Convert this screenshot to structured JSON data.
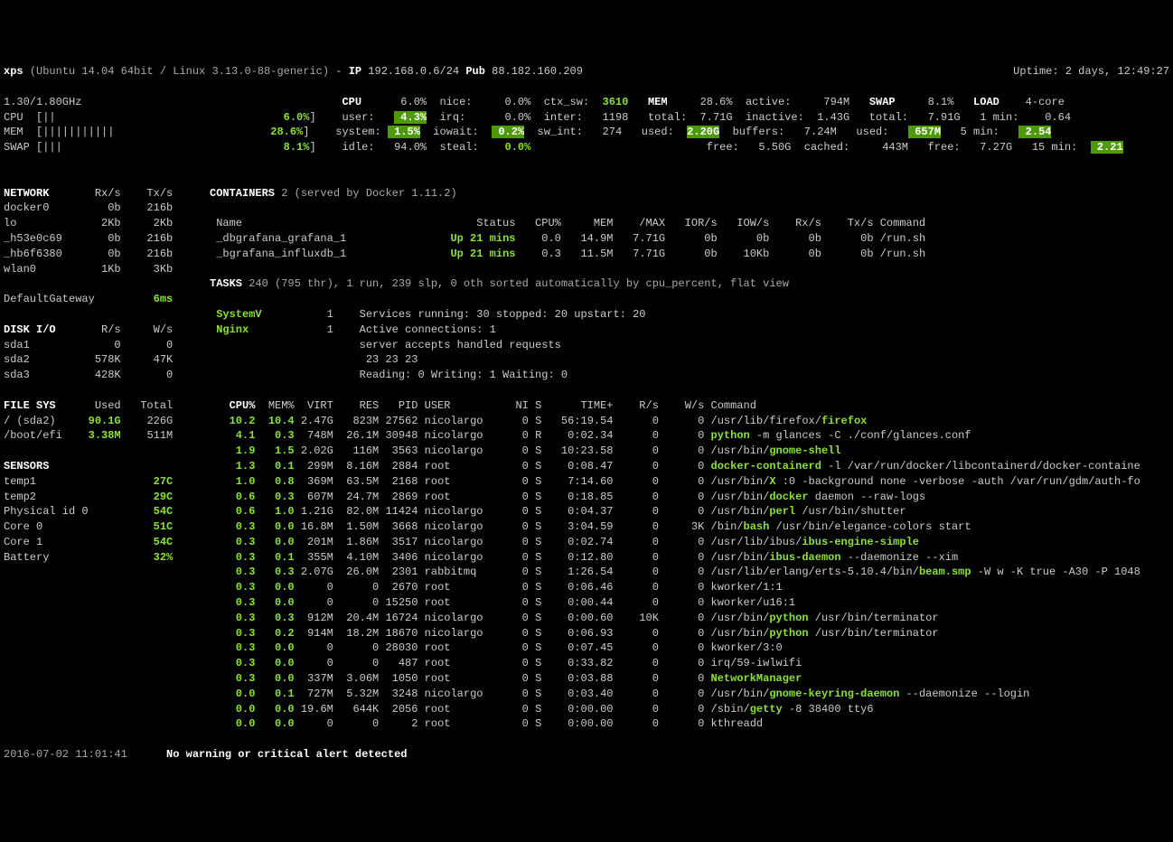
{
  "header": {
    "hostname": "xps",
    "os": "(Ubuntu 14.04 64bit / Linux 3.13.0-88-generic)",
    "ip_label": "IP",
    "ip": "192.168.0.6/24",
    "pub_label": "Pub",
    "pub": "88.182.160.209",
    "uptime": "Uptime: 2 days, 12:49:27"
  },
  "quickbar": {
    "freq": "1.30/1.80GHz",
    "cpu_bar": "CPU  [||",
    "cpu_pct": "6.0%",
    "mem_bar": "MEM  [|||||||||||",
    "mem_pct": "28.6%",
    "swap_bar": "SWAP [|||",
    "swap_pct": "8.1%"
  },
  "cpu": {
    "title": "CPU",
    "total": "6.0%",
    "user": "4.3%",
    "system": "1.5%",
    "idle": "94.0%",
    "nice": "0.0%",
    "irq": "0.0%",
    "iowait": "0.2%",
    "steal": "0.0%",
    "ctx_sw": "3610",
    "inter": "1198",
    "sw_int": "274"
  },
  "mem": {
    "title": "MEM",
    "pct": "28.6%",
    "total": "7.71G",
    "used": "2.20G",
    "free": "5.50G",
    "active": "794M",
    "inactive": "1.43G",
    "buffers": "7.24M",
    "cached": "443M"
  },
  "swap": {
    "title": "SWAP",
    "pct": "8.1%",
    "total": "7.91G",
    "used": "657M",
    "free": "7.27G"
  },
  "load": {
    "title": "LOAD",
    "core": "4-core",
    "min1": "0.64",
    "min5": "2.54",
    "min15": "2.21"
  },
  "network": {
    "title": "NETWORK",
    "cols": [
      "Rx/s",
      "Tx/s"
    ],
    "rows": [
      {
        "name": "docker0",
        "rx": "0b",
        "tx": "216b"
      },
      {
        "name": "lo",
        "rx": "2Kb",
        "tx": "2Kb"
      },
      {
        "name": "_h53e0c69",
        "rx": "0b",
        "tx": "216b"
      },
      {
        "name": "_hb6f6380",
        "rx": "0b",
        "tx": "216b"
      },
      {
        "name": "wlan0",
        "rx": "1Kb",
        "tx": "3Kb"
      }
    ],
    "gateway_label": "DefaultGateway",
    "gateway": "6ms"
  },
  "diskio": {
    "title": "DISK I/O",
    "cols": [
      "R/s",
      "W/s"
    ],
    "rows": [
      {
        "name": "sda1",
        "r": "0",
        "w": "0"
      },
      {
        "name": "sda2",
        "r": "578K",
        "w": "47K"
      },
      {
        "name": "sda3",
        "r": "428K",
        "w": "0"
      }
    ]
  },
  "fs": {
    "title": "FILE SYS",
    "cols": [
      "Used",
      "Total"
    ],
    "rows": [
      {
        "name": "/ (sda2)",
        "used": "90.1G",
        "total": "226G",
        "hl": true
      },
      {
        "name": "/boot/efi",
        "used": "3.38M",
        "total": "511M",
        "hl": true
      }
    ]
  },
  "sensors": {
    "title": "SENSORS",
    "rows": [
      {
        "name": "temp1",
        "val": "27C"
      },
      {
        "name": "temp2",
        "val": "29C"
      },
      {
        "name": "Physical id 0",
        "val": "54C"
      },
      {
        "name": "Core 0",
        "val": "51C"
      },
      {
        "name": "Core 1",
        "val": "54C"
      },
      {
        "name": "Battery",
        "val": "32%"
      }
    ]
  },
  "containers": {
    "title": "CONTAINERS",
    "count": "2",
    "served": "(served by Docker 1.11.2)",
    "header": [
      "Name",
      "Status",
      "CPU%",
      "MEM",
      "/MAX",
      "IOR/s",
      "IOW/s",
      "Rx/s",
      "Tx/s",
      "Command"
    ],
    "rows": [
      {
        "name": "_dbgrafana_grafana_1",
        "status": "Up 21 mins",
        "cpu": "0.0",
        "mem": "14.9M",
        "max": "7.71G",
        "ior": "0b",
        "iow": "0b",
        "rx": "0b",
        "tx": "0b",
        "cmd": "/run.sh"
      },
      {
        "name": "_bgrafana_influxdb_1",
        "status": "Up 21 mins",
        "cpu": "0.3",
        "mem": "11.5M",
        "max": "7.71G",
        "ior": "0b",
        "iow": "10Kb",
        "rx": "0b",
        "tx": "0b",
        "cmd": "/run.sh"
      }
    ]
  },
  "tasks": {
    "line": "TASKS 240 (795 thr), 1 run, 239 slp, 0 oth sorted automatically by cpu_percent, flat view"
  },
  "amp": {
    "systemv": {
      "label": "SystemV",
      "count": "1",
      "text": "Services running: 30 stopped: 20 upstart: 20"
    },
    "nginx": {
      "label": "Nginx",
      "count": "1",
      "lines": [
        "Active connections: 1",
        "server accepts handled requests",
        " 23 23 23",
        "Reading: 0 Writing: 1 Waiting: 0"
      ]
    }
  },
  "procs": {
    "header": [
      "CPU%",
      "MEM%",
      "VIRT",
      "RES",
      "PID",
      "USER",
      "NI",
      "S",
      "TIME+",
      "R/s",
      "W/s",
      "Command"
    ],
    "rows": [
      {
        "cpu": "10.2",
        "mem": "10.4",
        "virt": "2.47G",
        "res": "823M",
        "pid": "27562",
        "user": "nicolargo",
        "ni": "0",
        "s": "S",
        "time": "56:19.54",
        "r": "0",
        "w": "0",
        "cmd": "/usr/lib/firefox/",
        "cmdh": "firefox"
      },
      {
        "cpu": "4.1",
        "mem": "0.3",
        "virt": "748M",
        "res": "26.1M",
        "pid": "30948",
        "user": "nicolargo",
        "ni": "0",
        "s": "R",
        "time": "0:02.34",
        "r": "0",
        "w": "0",
        "cmd": "",
        "cmdh": "python",
        "cmds": " -m glances -C ./conf/glances.conf"
      },
      {
        "cpu": "1.9",
        "mem": "1.5",
        "virt": "2.02G",
        "res": "116M",
        "pid": "3563",
        "user": "nicolargo",
        "ni": "0",
        "s": "S",
        "time": "10:23.58",
        "r": "0",
        "w": "0",
        "cmd": "/usr/bin/",
        "cmdh": "gnome-shell"
      },
      {
        "cpu": "1.3",
        "mem": "0.1",
        "virt": "299M",
        "res": "8.16M",
        "pid": "2884",
        "user": "root",
        "ni": "0",
        "s": "S",
        "time": "0:08.47",
        "r": "0",
        "w": "0",
        "cmd": "",
        "cmdh": "docker-containerd",
        "cmds": " -l /var/run/docker/libcontainerd/docker-containe"
      },
      {
        "cpu": "1.0",
        "mem": "0.8",
        "virt": "369M",
        "res": "63.5M",
        "pid": "2168",
        "user": "root",
        "ni": "0",
        "s": "S",
        "time": "7:14.60",
        "r": "0",
        "w": "0",
        "cmd": "/usr/bin/",
        "cmdh": "X",
        "cmds": " :0 -background none -verbose -auth /var/run/gdm/auth-fo"
      },
      {
        "cpu": "0.6",
        "mem": "0.3",
        "virt": "607M",
        "res": "24.7M",
        "pid": "2869",
        "user": "root",
        "ni": "0",
        "s": "S",
        "time": "0:18.85",
        "r": "0",
        "w": "0",
        "cmd": "/usr/bin/",
        "cmdh": "docker",
        "cmds": " daemon --raw-logs"
      },
      {
        "cpu": "0.6",
        "mem": "1.0",
        "virt": "1.21G",
        "res": "82.0M",
        "pid": "11424",
        "user": "nicolargo",
        "ni": "0",
        "s": "S",
        "time": "0:04.37",
        "r": "0",
        "w": "0",
        "cmd": "/usr/bin/",
        "cmdh": "perl",
        "cmds": " /usr/bin/shutter"
      },
      {
        "cpu": "0.3",
        "mem": "0.0",
        "virt": "16.8M",
        "res": "1.50M",
        "pid": "3668",
        "user": "nicolargo",
        "ni": "0",
        "s": "S",
        "time": "3:04.59",
        "r": "0",
        "w": "3K",
        "cmd": "/bin/",
        "cmdh": "bash",
        "cmds": " /usr/bin/elegance-colors start"
      },
      {
        "cpu": "0.3",
        "mem": "0.0",
        "virt": "201M",
        "res": "1.86M",
        "pid": "3517",
        "user": "nicolargo",
        "ni": "0",
        "s": "S",
        "time": "0:02.74",
        "r": "0",
        "w": "0",
        "cmd": "/usr/lib/ibus/",
        "cmdh": "ibus-engine-simple"
      },
      {
        "cpu": "0.3",
        "mem": "0.1",
        "virt": "355M",
        "res": "4.10M",
        "pid": "3406",
        "user": "nicolargo",
        "ni": "0",
        "s": "S",
        "time": "0:12.80",
        "r": "0",
        "w": "0",
        "cmd": "/usr/bin/",
        "cmdh": "ibus-daemon",
        "cmds": " --daemonize --xim"
      },
      {
        "cpu": "0.3",
        "mem": "0.3",
        "virt": "2.07G",
        "res": "26.0M",
        "pid": "2301",
        "user": "rabbitmq",
        "ni": "0",
        "s": "S",
        "time": "1:26.54",
        "r": "0",
        "w": "0",
        "cmd": "/usr/lib/erlang/erts-5.10.4/bin/",
        "cmdh": "beam.smp",
        "cmds": " -W w -K true -A30 -P 1048"
      },
      {
        "cpu": "0.3",
        "mem": "0.0",
        "virt": "0",
        "res": "0",
        "pid": "2670",
        "user": "root",
        "ni": "0",
        "s": "S",
        "time": "0:06.46",
        "r": "0",
        "w": "0",
        "cmd": "kworker/1:1"
      },
      {
        "cpu": "0.3",
        "mem": "0.0",
        "virt": "0",
        "res": "0",
        "pid": "15250",
        "user": "root",
        "ni": "0",
        "s": "S",
        "time": "0:00.44",
        "r": "0",
        "w": "0",
        "cmd": "kworker/u16:1"
      },
      {
        "cpu": "0.3",
        "mem": "0.3",
        "virt": "912M",
        "res": "20.4M",
        "pid": "16724",
        "user": "nicolargo",
        "ni": "0",
        "s": "S",
        "time": "0:00.60",
        "r": "10K",
        "w": "0",
        "cmd": "/usr/bin/",
        "cmdh": "python",
        "cmds": " /usr/bin/terminator"
      },
      {
        "cpu": "0.3",
        "mem": "0.2",
        "virt": "914M",
        "res": "18.2M",
        "pid": "18670",
        "user": "nicolargo",
        "ni": "0",
        "s": "S",
        "time": "0:06.93",
        "r": "0",
        "w": "0",
        "cmd": "/usr/bin/",
        "cmdh": "python",
        "cmds": " /usr/bin/terminator"
      },
      {
        "cpu": "0.3",
        "mem": "0.0",
        "virt": "0",
        "res": "0",
        "pid": "28030",
        "user": "root",
        "ni": "0",
        "s": "S",
        "time": "0:07.45",
        "r": "0",
        "w": "0",
        "cmd": "kworker/3:0"
      },
      {
        "cpu": "0.3",
        "mem": "0.0",
        "virt": "0",
        "res": "0",
        "pid": "487",
        "user": "root",
        "ni": "0",
        "s": "S",
        "time": "0:33.82",
        "r": "0",
        "w": "0",
        "cmd": "irq/59-iwlwifi"
      },
      {
        "cpu": "0.3",
        "mem": "0.0",
        "virt": "337M",
        "res": "3.06M",
        "pid": "1050",
        "user": "root",
        "ni": "0",
        "s": "S",
        "time": "0:03.88",
        "r": "0",
        "w": "0",
        "cmd": "",
        "cmdh": "NetworkManager"
      },
      {
        "cpu": "0.0",
        "mem": "0.1",
        "virt": "727M",
        "res": "5.32M",
        "pid": "3248",
        "user": "nicolargo",
        "ni": "0",
        "s": "S",
        "time": "0:03.40",
        "r": "0",
        "w": "0",
        "cmd": "/usr/bin/",
        "cmdh": "gnome-keyring-daemon",
        "cmds": " --daemonize --login"
      },
      {
        "cpu": "0.0",
        "mem": "0.0",
        "virt": "19.6M",
        "res": "644K",
        "pid": "2056",
        "user": "root",
        "ni": "0",
        "s": "S",
        "time": "0:00.00",
        "r": "0",
        "w": "0",
        "cmd": "/sbin/",
        "cmdh": "getty",
        "cmds": " -8 38400 tty6"
      },
      {
        "cpu": "0.0",
        "mem": "0.0",
        "virt": "0",
        "res": "0",
        "pid": "2",
        "user": "root",
        "ni": "0",
        "s": "S",
        "time": "0:00.00",
        "r": "0",
        "w": "0",
        "cmd": "kthreadd"
      }
    ]
  },
  "footer": {
    "time": "2016-07-02 11:01:41",
    "alert": "No warning or critical alert detected"
  }
}
